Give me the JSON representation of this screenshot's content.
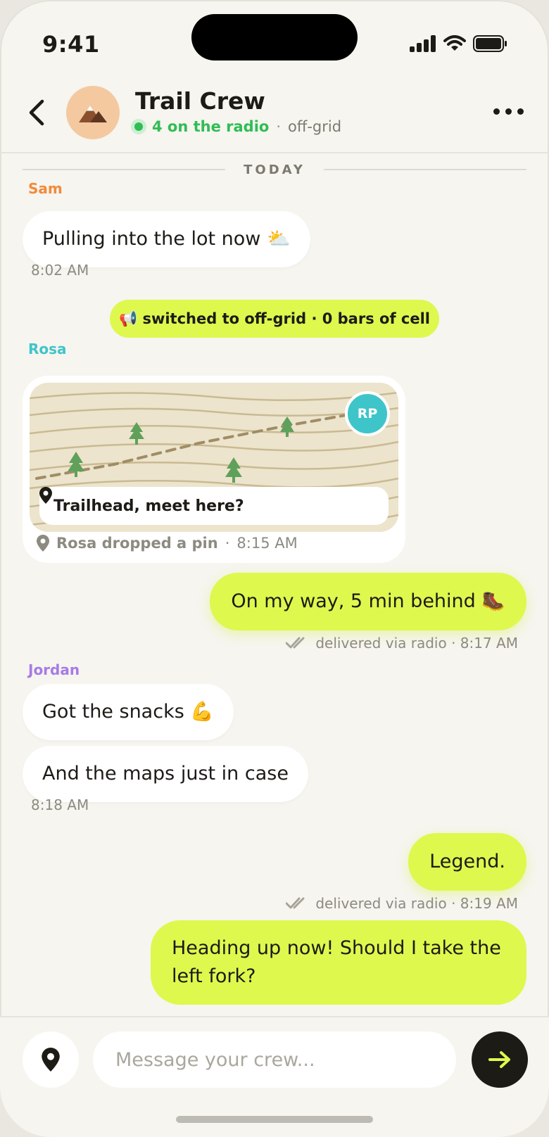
{
  "status": {
    "time": "9:41"
  },
  "header": {
    "title": "Trail Crew",
    "online": "4 on the radio",
    "separator": "·",
    "mode": "off-grid"
  },
  "chat": {
    "day_divider": "TODAY",
    "messages": [
      {
        "sender": "Sam",
        "sender_color": "#f38a3b",
        "text": "Pulling into the lot now ⛅",
        "time": "8:02 AM"
      },
      {
        "system": "📢 switched to off-grid · 0 bars of cell"
      },
      {
        "sender": "Rosa",
        "sender_color": "#3ec5c9",
        "pin_label": "Trailhead, meet here?",
        "pin_badge": "RP",
        "meta": "Rosa dropped a pin",
        "meta_sep": "·",
        "time": "8:15 AM"
      },
      {
        "outgoing": true,
        "text": "On my way, 5 min behind 🥾",
        "receipt": "delivered via radio · 8:17 AM"
      },
      {
        "sender": "Jordan",
        "sender_color": "#a77be6",
        "text": "Got the snacks 💪",
        "text2": "And the maps just in case",
        "time": "8:18 AM"
      },
      {
        "outgoing": true,
        "text": "Legend.",
        "receipt": "delivered via radio · 8:19 AM"
      },
      {
        "outgoing": true,
        "text": "Heading up now! Should I take the left fork?"
      }
    ]
  },
  "composer": {
    "placeholder": "Message your crew..."
  },
  "colors": {
    "accent": "#dff84e",
    "online": "#2fbd55",
    "sam": "#f38a3b",
    "rosa": "#3ec5c9",
    "jordan": "#a77be6"
  },
  "icons": [
    "back-chevron-icon",
    "mountain-avatar-icon",
    "more-dots-icon",
    "location-pin-icon",
    "double-check-icon",
    "send-arrow-icon",
    "signal-icon",
    "wifi-icon",
    "battery-icon"
  ]
}
